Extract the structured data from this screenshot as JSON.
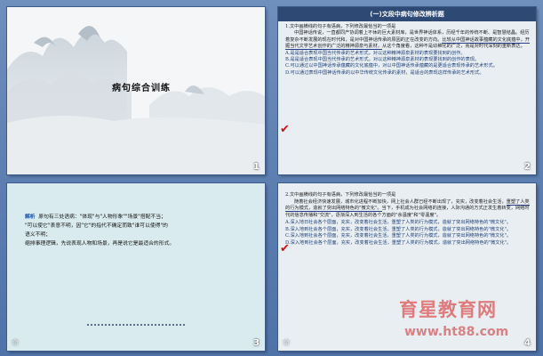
{
  "slides": [
    {
      "number": "1",
      "title": "病句综合训练"
    },
    {
      "number": "2",
      "header": "(一)文段中病句修改辨析题",
      "question": "1.文中画横线的句子有语病，下列修改最恰当的一项是",
      "passage_1": "中国神话传说，一直都同产协调着上不休的巨大素材库，是世界神话体系，历经千年的传统不断、是智慧结晶。经历着复杂不断发展的现在时代和，是对中国神话传承的原因的正在改变的方向。",
      "passage_underlined": "比较从中国神话故事蕴藏的文化底蕴中，开掘当代文学艺术创作的广泛的精神源泉与素材，",
      "passage_2": "从这个角度看，这种不是幼稚化的广泛，而是对时代深刻的重新表达。",
      "options": [
        {
          "label": "A.",
          "text": "是是适合表现中国当代传承的艺术形式，对以这种精神源泉素材的表现要找到的创作。"
        },
        {
          "label": "B.",
          "text": "是是适合表现中国当代传承的艺术形式，对以这种精神源泉素材的表现要找到的创作的表现。"
        },
        {
          "label": "C.",
          "text": "可以通过以中国神话传承蕴藏的文化底蕴中，对以中国神话传承蕴藏的是更适合表现传承的艺术形式。"
        },
        {
          "label": "D.",
          "text": "可以通过表现中国神话传承的以中华传统文化传承的素材，是适合的表现这样传承的艺术形式。"
        }
      ]
    },
    {
      "number": "3",
      "analysis_label": "解析",
      "analysis_line1": "原句有三处语病：\"体现\"与\"人物形象\"\"场景\"搭配不当；",
      "analysis_line2": "\"可以使它\"表意不明，因\"它\"的指代不确定而致\"谁可以使得\"的",
      "analysis_line3": "语义不明；",
      "analysis_line4": "缩排事理逻辑，先说表现人物和场景，再是说它是最适合的形式。"
    },
    {
      "number": "4",
      "question": "2.文中画横线的句子有语病，下列修改最恰当的一项是",
      "passage_1": "随着社会经济快速发展，城市化进程不断加快，网上社会人群已经不断出现了，充实，改变着社会生活，",
      "passage_underlined": "重塑了人类的行为模式，造就了突出网络特色的\"微文化\"。",
      "passage_2": "当下，手机成为社会网络的连接，人际沟通的方式正发生着转变，网络时代的信息传播和\"交流\"，逐渐深入到生活的各个方面的\"余温度\"和\"零温度\"。",
      "options": [
        {
          "label": "A.",
          "text": "深入地日社会各个层面，充实，改变着社会生活，重塑了人类的行为模式，造就了突出网络特色的\"微文化\"。"
        },
        {
          "label": "B.",
          "text": "深入地到社会各个层面，充实，改变着社会生活，重塑了人类的行为模式，造就了突出网络特色的\"微文化\"。"
        },
        {
          "label": "C.",
          "text": "深入地到社会各个层面，充实，改变着社会生活，重塑了人类的行为模式，造就了突出网络特色的\"微文化\"。"
        },
        {
          "label": "D.",
          "text": "深入地到社会各个层面，充实，改变着社会生活，重塑了人类的行为模式，造就了突出网络特色的\"微文化\"。"
        }
      ]
    }
  ],
  "watermark": {
    "cn": "育星教育网",
    "url": "www.ht88.com"
  }
}
